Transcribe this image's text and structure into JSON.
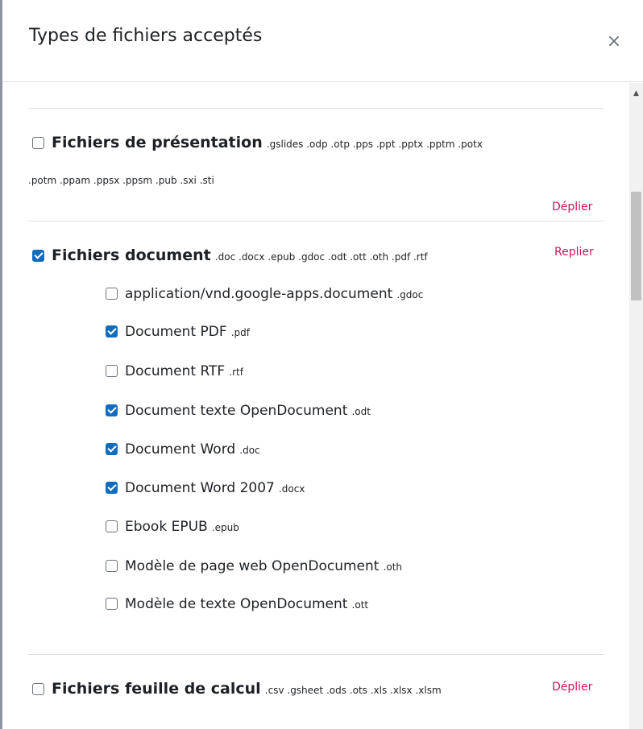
{
  "dialog": {
    "title": "Types de fichiers acceptés",
    "close_glyph": "×",
    "close_icon": "close-icon"
  },
  "groups": [
    {
      "name": "Fichiers de présentation",
      "checked": false,
      "extensions_line1": ".gslides .odp .otp .pps .ppt .pptx .pptm .potx",
      "extensions_line2": ".potm .ppam .ppsx .ppsm .pub .sxi .sti",
      "toggle_label": "Déplier"
    },
    {
      "name": "Fichiers document",
      "checked": true,
      "extensions": ".doc .docx .epub .gdoc .odt .ott .oth .pdf .rtf",
      "toggle_label": "Replier",
      "items": [
        {
          "label": "application/vnd.google-apps.document",
          "ext": ".gdoc",
          "checked": false
        },
        {
          "label": "Document PDF",
          "ext": ".pdf",
          "checked": true
        },
        {
          "label": "Document RTF",
          "ext": ".rtf",
          "checked": false
        },
        {
          "label": "Document texte OpenDocument",
          "ext": ".odt",
          "checked": true
        },
        {
          "label": "Document Word",
          "ext": ".doc",
          "checked": true
        },
        {
          "label": "Document Word 2007",
          "ext": ".docx",
          "checked": true
        },
        {
          "label": "Ebook EPUB",
          "ext": ".epub",
          "checked": false
        },
        {
          "label": "Modèle de page web OpenDocument",
          "ext": ".oth",
          "checked": false
        },
        {
          "label": "Modèle de texte OpenDocument",
          "ext": ".ott",
          "checked": false
        }
      ]
    },
    {
      "name": "Fichiers feuille de calcul",
      "checked": false,
      "extensions": ".csv .gsheet .ods .ots .xls .xlsx .xlsm",
      "toggle_label": "Déplier"
    }
  ],
  "colors": {
    "accent_link": "#c5175f",
    "checkbox_checked": "#0f6cbf",
    "text": "#1d2125",
    "divider": "#dee2e6"
  }
}
